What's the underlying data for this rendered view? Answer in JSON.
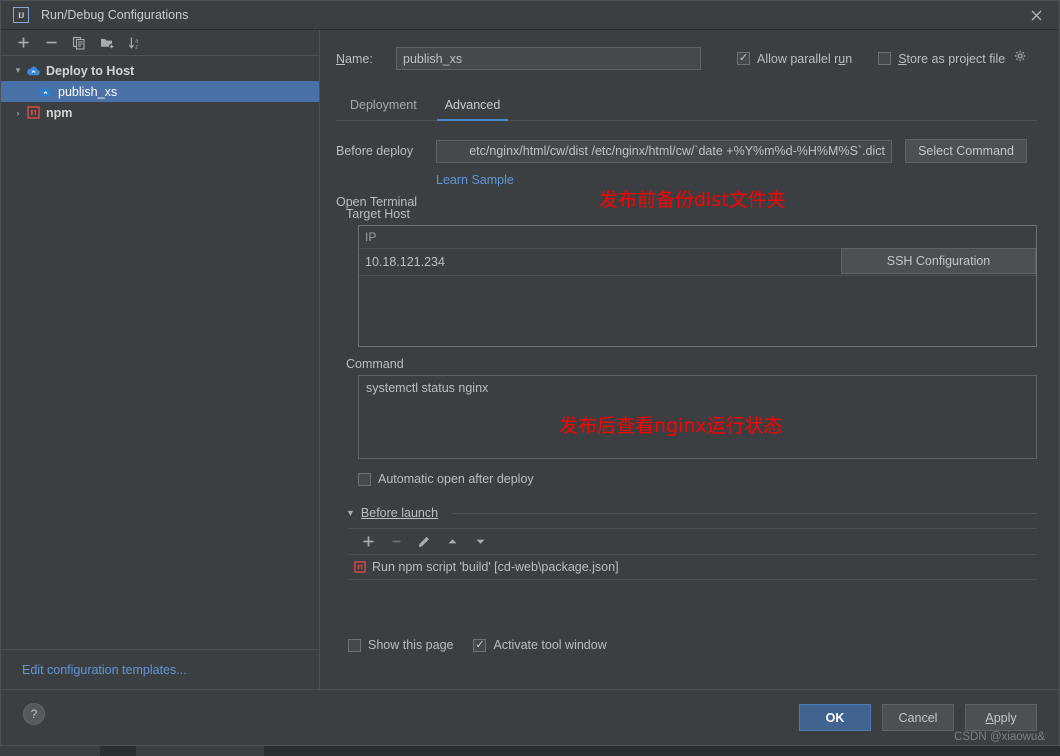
{
  "window": {
    "title": "Run/Debug Configurations",
    "logo_text": "IJ",
    "close_label": "✕"
  },
  "sidebar": {
    "toolbar": [
      {
        "name": "add-configuration-button",
        "glyph": "+"
      },
      {
        "name": "remove-configuration-button",
        "glyph": "−"
      },
      {
        "name": "copy-configuration-button",
        "glyph": "copy-icon"
      },
      {
        "name": "new-folder-button",
        "glyph": "folder-add-icon"
      },
      {
        "name": "sort-configurations-button",
        "glyph": "sort-az-icon"
      }
    ],
    "tree": [
      {
        "label": "Deploy to Host",
        "icon": "cloud-icon",
        "expanded": true,
        "level": 0,
        "selected": false,
        "twisty": "▾"
      },
      {
        "label": "publish_xs",
        "icon": "cloud-icon",
        "expanded": false,
        "level": 1,
        "selected": true,
        "twisty": ""
      },
      {
        "label": "npm",
        "icon": "npm-icon",
        "expanded": false,
        "level": 0,
        "selected": false,
        "twisty": "›"
      }
    ],
    "edit_templates_link": "Edit configuration templates..."
  },
  "form": {
    "name_label": "Name:",
    "name_value": "publish_xs",
    "allow_parallel_run_label": "Allow parallel run",
    "allow_parallel_run_checked": true,
    "store_as_project_file_label": "Store as project file",
    "store_as_project_file_checked": false,
    "store_gear_icon": "gear-icon",
    "tabs": [
      {
        "label": "Deployment",
        "active": false
      },
      {
        "label": "Advanced",
        "active": true
      }
    ],
    "before_deploy_label": "Before deploy",
    "before_deploy_value": "etc/nginx/html/cw/dist /etc/nginx/html/cw/`date +%Y%m%d-%H%M%S`.dict",
    "select_command_button": "Select Command",
    "learn_sample_link": "Learn Sample",
    "open_terminal_label": "Open Terminal",
    "target_host_label": "Target Host",
    "target_host_columns": [
      "IP"
    ],
    "target_host_rows": [
      [
        "10.18.121.234"
      ]
    ],
    "ssh_configuration_button": "SSH Configuration",
    "command_label": "Command",
    "command_value": "systemctl status nginx",
    "automatic_open_label": "Automatic open after deploy",
    "automatic_open_checked": false,
    "before_launch_label": "Before launch",
    "before_launch_toolbar": [
      {
        "name": "add-task-button",
        "glyph": "+",
        "enabled": true
      },
      {
        "name": "remove-task-button",
        "glyph": "−",
        "enabled": false
      },
      {
        "name": "edit-task-button",
        "glyph": "pencil-icon",
        "enabled": true
      },
      {
        "name": "move-up-button",
        "glyph": "▲",
        "enabled": true
      },
      {
        "name": "move-down-button",
        "glyph": "▼",
        "enabled": true
      }
    ],
    "before_launch_items": [
      {
        "icon": "npm-icon",
        "label": "Run npm script 'build' [cd-web\\package.json]"
      }
    ],
    "show_this_page_label": "Show this page",
    "show_this_page_checked": false,
    "activate_tool_window_label": "Activate tool window",
    "activate_tool_window_checked": true
  },
  "annotations": [
    {
      "text": "发布前备份dist文件夹",
      "color": "#ff0000"
    },
    {
      "text": "发布后查看nginx运行状态",
      "color": "#ff0000"
    }
  ],
  "footer": {
    "help_label": "?",
    "ok_label": "OK",
    "cancel_label": "Cancel",
    "apply_label": "Apply",
    "watermark": "CSDN @xiaowu&"
  },
  "colors": {
    "accent_blue": "#4a88c7",
    "selection_blue": "#4a70a8",
    "link_blue": "#5f96da",
    "annotation_red": "#ff0000",
    "panel_bg": "#3c3f41",
    "input_bg": "#45494a"
  }
}
